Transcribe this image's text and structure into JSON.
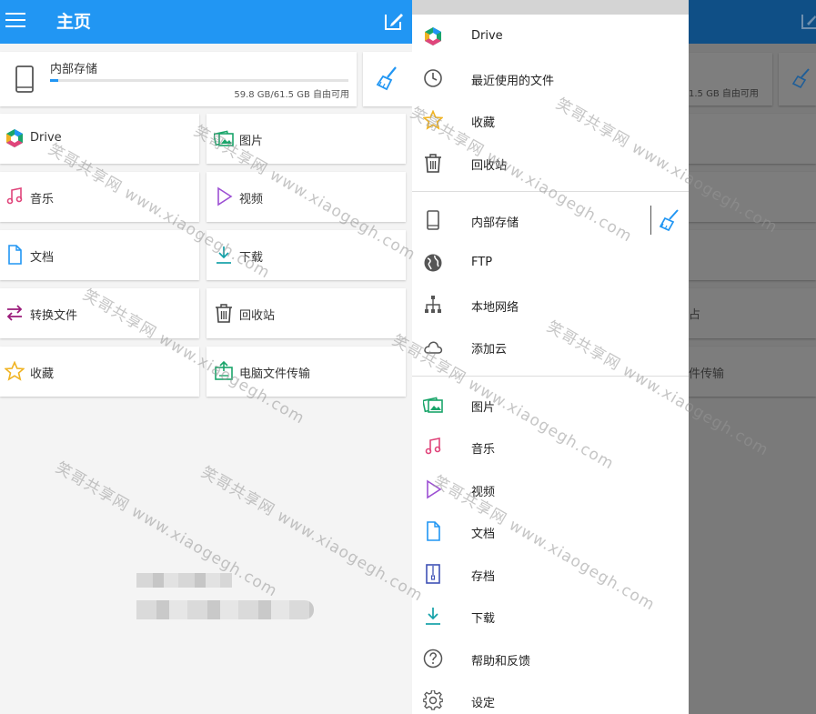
{
  "header": {
    "title": "主页"
  },
  "storage": {
    "label": "内部存储",
    "free_text": "59.8 GB/61.5 GB 自由可用",
    "used_fraction": 0.028
  },
  "tiles": [
    {
      "label": "Drive",
      "icon": "drive-icon"
    },
    {
      "label": "图片",
      "icon": "images-icon"
    },
    {
      "label": "音乐",
      "icon": "music-icon"
    },
    {
      "label": "视频",
      "icon": "video-icon"
    },
    {
      "label": "文档",
      "icon": "document-icon"
    },
    {
      "label": "下载",
      "icon": "download-icon"
    },
    {
      "label": "转换文件",
      "icon": "convert-icon"
    },
    {
      "label": "回收站",
      "icon": "recycle-bin-icon"
    },
    {
      "label": "收藏",
      "icon": "star-icon"
    },
    {
      "label": "电脑文件传输",
      "icon": "pc-transfer-icon"
    }
  ],
  "drawer": {
    "items": [
      {
        "label": "Drive",
        "icon": "drive-icon"
      },
      {
        "label": "最近使用的文件",
        "icon": "clock-icon"
      },
      {
        "label": "收藏",
        "icon": "star-icon"
      },
      {
        "label": "回收站",
        "icon": "recycle-bin-icon"
      },
      {
        "label": "内部存储",
        "icon": "phone-icon"
      },
      {
        "label": "FTP",
        "icon": "globe-icon"
      },
      {
        "label": "本地网络",
        "icon": "network-icon"
      },
      {
        "label": "添加云",
        "icon": "cloud-icon"
      },
      {
        "label": "图片",
        "icon": "images-icon"
      },
      {
        "label": "音乐",
        "icon": "music-icon"
      },
      {
        "label": "视频",
        "icon": "video-icon"
      },
      {
        "label": "文档",
        "icon": "document-icon"
      },
      {
        "label": "存档",
        "icon": "archive-icon"
      },
      {
        "label": "下载",
        "icon": "download-icon"
      },
      {
        "label": "帮助和反馈",
        "icon": "help-icon"
      },
      {
        "label": "设定",
        "icon": "settings-icon"
      }
    ]
  },
  "background_right": {
    "storage_free_partial": "1.5 GB 自由可用",
    "row4_partial": "占",
    "row5_partial": "件传输"
  },
  "watermark": "笑哥共享网 www.xiaogegh.com",
  "colors": {
    "primary": "#2196f3",
    "primary_dark_dimmed": "#0f4f86",
    "accent_green": "#1aa56a",
    "accent_pink": "#e0457b",
    "accent_purple": "#9c4fd3",
    "accent_gold": "#f0b323"
  }
}
